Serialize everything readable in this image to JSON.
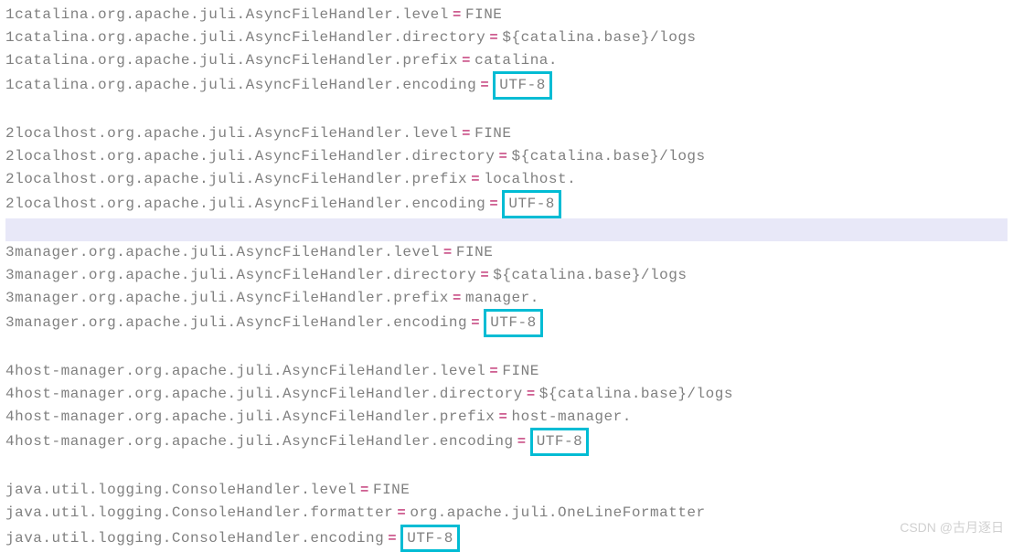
{
  "blocks": [
    {
      "prefix": "1catalina",
      "lines": [
        {
          "key": "level",
          "value": "FINE",
          "boxed": false
        },
        {
          "key": "directory",
          "value": "${catalina.base}/logs",
          "boxed": false
        },
        {
          "key": "prefix",
          "value": "catalina.",
          "boxed": false
        },
        {
          "key": "encoding",
          "value": "UTF-8",
          "boxed": true
        }
      ]
    },
    {
      "prefix": "2localhost",
      "lines": [
        {
          "key": "level",
          "value": "FINE",
          "boxed": false
        },
        {
          "key": "directory",
          "value": "${catalina.base}/logs",
          "boxed": false
        },
        {
          "key": "prefix",
          "value": "localhost.",
          "boxed": false
        },
        {
          "key": "encoding",
          "value": "UTF-8",
          "boxed": true
        }
      ]
    },
    {
      "prefix": "3manager",
      "lines": [
        {
          "key": "level",
          "value": "FINE",
          "boxed": false
        },
        {
          "key": "directory",
          "value": "${catalina.base}/logs",
          "boxed": false
        },
        {
          "key": "prefix",
          "value": "manager.",
          "boxed": false
        },
        {
          "key": "encoding",
          "value": "UTF-8",
          "boxed": true
        }
      ]
    },
    {
      "prefix": "4host-manager",
      "lines": [
        {
          "key": "level",
          "value": "FINE",
          "boxed": false
        },
        {
          "key": "directory",
          "value": "${catalina.base}/logs",
          "boxed": false
        },
        {
          "key": "prefix",
          "value": "host-manager.",
          "boxed": false
        },
        {
          "key": "encoding",
          "value": "UTF-8",
          "boxed": true
        }
      ]
    }
  ],
  "handler_class": ".org.apache.juli.AsyncFileHandler.",
  "console_block": {
    "prefix": "java.util.logging.ConsoleHandler.",
    "lines": [
      {
        "key": "level",
        "value": "FINE",
        "boxed": false
      },
      {
        "key": "formatter",
        "value": "org.apache.juli.OneLineFormatter",
        "boxed": false
      },
      {
        "key": "encoding",
        "value": "UTF-8",
        "boxed": true
      }
    ]
  },
  "highlight_after_block_index": 1,
  "equals_sign": "=",
  "watermark": "CSDN @古月逐日"
}
